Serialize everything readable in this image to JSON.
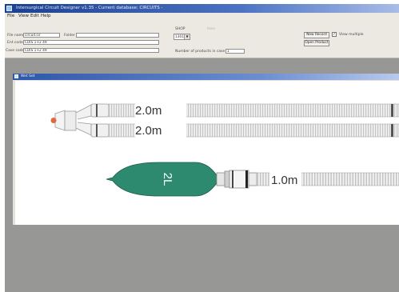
{
  "window": {
    "title": "Intersurgical Circuit Designer v1.35  -  Current database: CIRCUITS  -"
  },
  "menu": {
    "items": [
      "File",
      "View",
      "Edit",
      "Help"
    ]
  },
  "toolbar": {
    "file_name_label": "File name",
    "file_name_value": "circuit.cir",
    "folder_label": "Folder",
    "folder_value": "",
    "ent_code_label": "Ent code",
    "ent_code_value": "CDIS 1+2 49",
    "case_code_label": "Case code",
    "case_code_value": "CDIS 1+2 49",
    "shop_label": "SHOP",
    "shop_value": "1301",
    "dimmed_label": "Item",
    "products_label": "Number of products in case",
    "products_value": "1",
    "new_record_label": "New Record",
    "view_multiple_label": "View multiple",
    "view_multiple_checked": true,
    "open_product_label": "Open Product"
  },
  "child_window": {
    "title": "Wet Set"
  },
  "diagram": {
    "tube1_length": "2.0m",
    "tube2_length": "2.0m",
    "bag_volume": "2L",
    "hose_length": "1.0m",
    "colors": {
      "bag": "#2e8a6e",
      "tip": "#e06a3a",
      "tube": "#f2f2f2"
    }
  }
}
